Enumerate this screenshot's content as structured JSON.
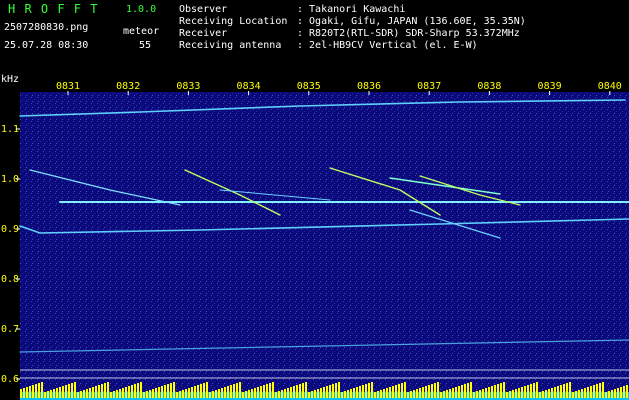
{
  "header": {
    "app_title": "H R O F F T",
    "version": "1.0.0",
    "filename": "2507280830.png",
    "datetime": "25.07.28 08:30",
    "meteor_label": "meteor",
    "meteor_count": "55",
    "info_lines": [
      {
        "label": "Observer",
        "value": ": Takanori Kawachi"
      },
      {
        "label": "Receiving Location",
        "value": ": Ogaki, Gifu, JAPAN (136.60E, 35.35N)"
      },
      {
        "label": "Receiver",
        "value": ": R820T2(RTL-SDR) SDR-Sharp 53.372MHz"
      },
      {
        "label": "Receiving antenna",
        "value": ": 2el-HB9CV Vertical (el. E-W)"
      }
    ]
  },
  "spectrogram": {
    "unit_label": "kHz",
    "time_ticks": [
      "0831",
      "0832",
      "0833",
      "0834",
      "0835",
      "0836",
      "0837",
      "0838",
      "0839",
      "0840"
    ],
    "freq_ticks": [
      "1.1",
      "1.0",
      "0.9",
      "0.8",
      "0.7",
      "0.6"
    ],
    "colors": {
      "background": "#0a0a7a",
      "header_green": "#33ff33",
      "tick_yellow": "#ffff00",
      "trace": "#60d0ff",
      "bars": "#ffff00",
      "bars_base": "#00bfff"
    }
  }
}
